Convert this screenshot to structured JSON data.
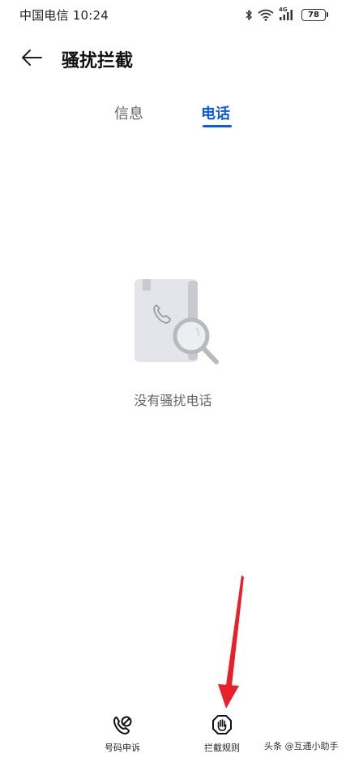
{
  "status_bar": {
    "carrier_time": "中国电信 10:24",
    "network_label": "4G",
    "battery_level": "78",
    "icons": [
      "bluetooth-icon",
      "wifi-icon",
      "cellular-signal-icon",
      "battery-icon"
    ]
  },
  "header": {
    "back_icon": "arrow-left-icon",
    "title": "骚扰拦截"
  },
  "tabs": [
    {
      "label": "信息",
      "selected": false
    },
    {
      "label": "电话",
      "selected": true
    }
  ],
  "empty_state": {
    "illustration": "phone-book-search-icon",
    "message": "没有骚扰电话"
  },
  "bottom_bar": {
    "items": [
      {
        "label": "号码申诉",
        "icon": "phone-appeal-icon"
      },
      {
        "label": "拦截规则",
        "icon": "hand-stop-icon"
      }
    ]
  },
  "watermark": "头条 @互通小助手",
  "colors": {
    "accent": "#0a59f7",
    "annotation_arrow": "#e8202a"
  }
}
